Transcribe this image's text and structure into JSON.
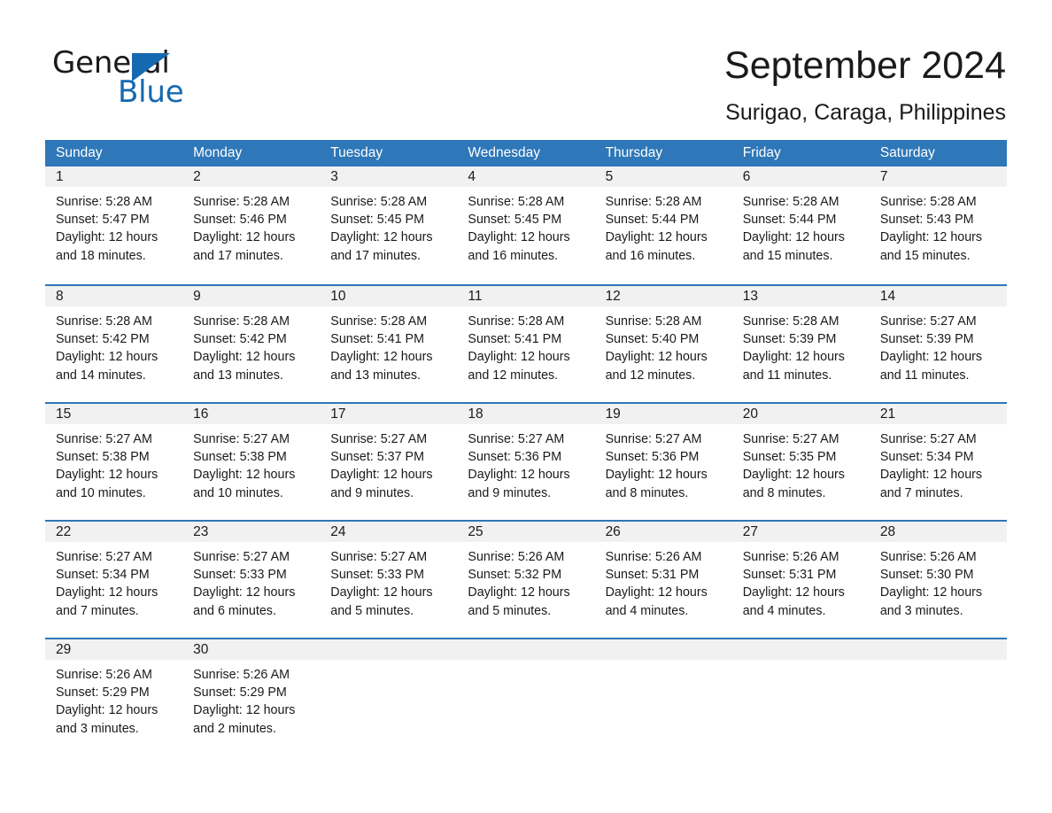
{
  "brand": {
    "name_part1": "General",
    "name_part2": "Blue",
    "triangle_icon": "triangle-icon",
    "accent_color": "#1569b0"
  },
  "header": {
    "title": "September 2024",
    "subtitle": "Surigao, Caraga, Philippines"
  },
  "theme": {
    "header_row_color": "#2e77b8",
    "day_band_color": "#f1f1f1",
    "text_color": "#1a1a1a"
  },
  "weekdays": [
    "Sunday",
    "Monday",
    "Tuesday",
    "Wednesday",
    "Thursday",
    "Friday",
    "Saturday"
  ],
  "weeks": [
    {
      "days": [
        {
          "num": "1",
          "sunrise": "Sunrise: 5:28 AM",
          "sunset": "Sunset: 5:47 PM",
          "daylight": "Daylight: 12 hours and 18 minutes."
        },
        {
          "num": "2",
          "sunrise": "Sunrise: 5:28 AM",
          "sunset": "Sunset: 5:46 PM",
          "daylight": "Daylight: 12 hours and 17 minutes."
        },
        {
          "num": "3",
          "sunrise": "Sunrise: 5:28 AM",
          "sunset": "Sunset: 5:45 PM",
          "daylight": "Daylight: 12 hours and 17 minutes."
        },
        {
          "num": "4",
          "sunrise": "Sunrise: 5:28 AM",
          "sunset": "Sunset: 5:45 PM",
          "daylight": "Daylight: 12 hours and 16 minutes."
        },
        {
          "num": "5",
          "sunrise": "Sunrise: 5:28 AM",
          "sunset": "Sunset: 5:44 PM",
          "daylight": "Daylight: 12 hours and 16 minutes."
        },
        {
          "num": "6",
          "sunrise": "Sunrise: 5:28 AM",
          "sunset": "Sunset: 5:44 PM",
          "daylight": "Daylight: 12 hours and 15 minutes."
        },
        {
          "num": "7",
          "sunrise": "Sunrise: 5:28 AM",
          "sunset": "Sunset: 5:43 PM",
          "daylight": "Daylight: 12 hours and 15 minutes."
        }
      ]
    },
    {
      "days": [
        {
          "num": "8",
          "sunrise": "Sunrise: 5:28 AM",
          "sunset": "Sunset: 5:42 PM",
          "daylight": "Daylight: 12 hours and 14 minutes."
        },
        {
          "num": "9",
          "sunrise": "Sunrise: 5:28 AM",
          "sunset": "Sunset: 5:42 PM",
          "daylight": "Daylight: 12 hours and 13 minutes."
        },
        {
          "num": "10",
          "sunrise": "Sunrise: 5:28 AM",
          "sunset": "Sunset: 5:41 PM",
          "daylight": "Daylight: 12 hours and 13 minutes."
        },
        {
          "num": "11",
          "sunrise": "Sunrise: 5:28 AM",
          "sunset": "Sunset: 5:41 PM",
          "daylight": "Daylight: 12 hours and 12 minutes."
        },
        {
          "num": "12",
          "sunrise": "Sunrise: 5:28 AM",
          "sunset": "Sunset: 5:40 PM",
          "daylight": "Daylight: 12 hours and 12 minutes."
        },
        {
          "num": "13",
          "sunrise": "Sunrise: 5:28 AM",
          "sunset": "Sunset: 5:39 PM",
          "daylight": "Daylight: 12 hours and 11 minutes."
        },
        {
          "num": "14",
          "sunrise": "Sunrise: 5:27 AM",
          "sunset": "Sunset: 5:39 PM",
          "daylight": "Daylight: 12 hours and 11 minutes."
        }
      ]
    },
    {
      "days": [
        {
          "num": "15",
          "sunrise": "Sunrise: 5:27 AM",
          "sunset": "Sunset: 5:38 PM",
          "daylight": "Daylight: 12 hours and 10 minutes."
        },
        {
          "num": "16",
          "sunrise": "Sunrise: 5:27 AM",
          "sunset": "Sunset: 5:38 PM",
          "daylight": "Daylight: 12 hours and 10 minutes."
        },
        {
          "num": "17",
          "sunrise": "Sunrise: 5:27 AM",
          "sunset": "Sunset: 5:37 PM",
          "daylight": "Daylight: 12 hours and 9 minutes."
        },
        {
          "num": "18",
          "sunrise": "Sunrise: 5:27 AM",
          "sunset": "Sunset: 5:36 PM",
          "daylight": "Daylight: 12 hours and 9 minutes."
        },
        {
          "num": "19",
          "sunrise": "Sunrise: 5:27 AM",
          "sunset": "Sunset: 5:36 PM",
          "daylight": "Daylight: 12 hours and 8 minutes."
        },
        {
          "num": "20",
          "sunrise": "Sunrise: 5:27 AM",
          "sunset": "Sunset: 5:35 PM",
          "daylight": "Daylight: 12 hours and 8 minutes."
        },
        {
          "num": "21",
          "sunrise": "Sunrise: 5:27 AM",
          "sunset": "Sunset: 5:34 PM",
          "daylight": "Daylight: 12 hours and 7 minutes."
        }
      ]
    },
    {
      "days": [
        {
          "num": "22",
          "sunrise": "Sunrise: 5:27 AM",
          "sunset": "Sunset: 5:34 PM",
          "daylight": "Daylight: 12 hours and 7 minutes."
        },
        {
          "num": "23",
          "sunrise": "Sunrise: 5:27 AM",
          "sunset": "Sunset: 5:33 PM",
          "daylight": "Daylight: 12 hours and 6 minutes."
        },
        {
          "num": "24",
          "sunrise": "Sunrise: 5:27 AM",
          "sunset": "Sunset: 5:33 PM",
          "daylight": "Daylight: 12 hours and 5 minutes."
        },
        {
          "num": "25",
          "sunrise": "Sunrise: 5:26 AM",
          "sunset": "Sunset: 5:32 PM",
          "daylight": "Daylight: 12 hours and 5 minutes."
        },
        {
          "num": "26",
          "sunrise": "Sunrise: 5:26 AM",
          "sunset": "Sunset: 5:31 PM",
          "daylight": "Daylight: 12 hours and 4 minutes."
        },
        {
          "num": "27",
          "sunrise": "Sunrise: 5:26 AM",
          "sunset": "Sunset: 5:31 PM",
          "daylight": "Daylight: 12 hours and 4 minutes."
        },
        {
          "num": "28",
          "sunrise": "Sunrise: 5:26 AM",
          "sunset": "Sunset: 5:30 PM",
          "daylight": "Daylight: 12 hours and 3 minutes."
        }
      ]
    },
    {
      "days": [
        {
          "num": "29",
          "sunrise": "Sunrise: 5:26 AM",
          "sunset": "Sunset: 5:29 PM",
          "daylight": "Daylight: 12 hours and 3 minutes."
        },
        {
          "num": "30",
          "sunrise": "Sunrise: 5:26 AM",
          "sunset": "Sunset: 5:29 PM",
          "daylight": "Daylight: 12 hours and 2 minutes."
        },
        {
          "num": "",
          "sunrise": "",
          "sunset": "",
          "daylight": ""
        },
        {
          "num": "",
          "sunrise": "",
          "sunset": "",
          "daylight": ""
        },
        {
          "num": "",
          "sunrise": "",
          "sunset": "",
          "daylight": ""
        },
        {
          "num": "",
          "sunrise": "",
          "sunset": "",
          "daylight": ""
        },
        {
          "num": "",
          "sunrise": "",
          "sunset": "",
          "daylight": ""
        }
      ]
    }
  ]
}
